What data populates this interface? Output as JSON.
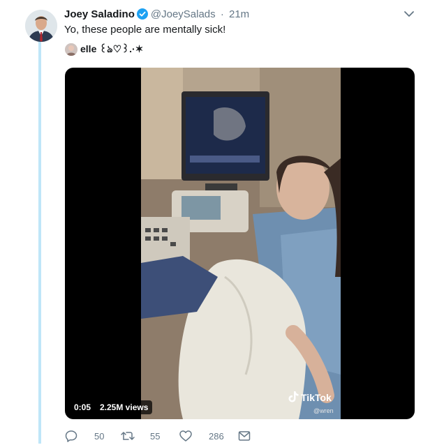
{
  "tweet": {
    "display_name": "Joey Saladino",
    "handle": "@JoeySalads",
    "separator": "·",
    "time": "21m",
    "text": "Yo, these people are mentally sick!",
    "verified": true
  },
  "quoted": {
    "display_name": "elle ꒰ঌ♡꒱.·✶"
  },
  "video": {
    "elapsed": "0:05",
    "views": "2.25M views",
    "watermark_brand": "TikTok",
    "watermark_handle": "@wren"
  },
  "actions": {
    "replies": "50",
    "retweets": "55",
    "likes": "286"
  },
  "colors": {
    "thread_line": "#bfe6f8",
    "verified_blue": "#1da1f2",
    "secondary_text": "#657786"
  },
  "icons": [
    "chevron-down-icon",
    "verified-badge-icon",
    "reply-icon",
    "retweet-icon",
    "like-icon",
    "share-icon",
    "tiktok-icon"
  ]
}
